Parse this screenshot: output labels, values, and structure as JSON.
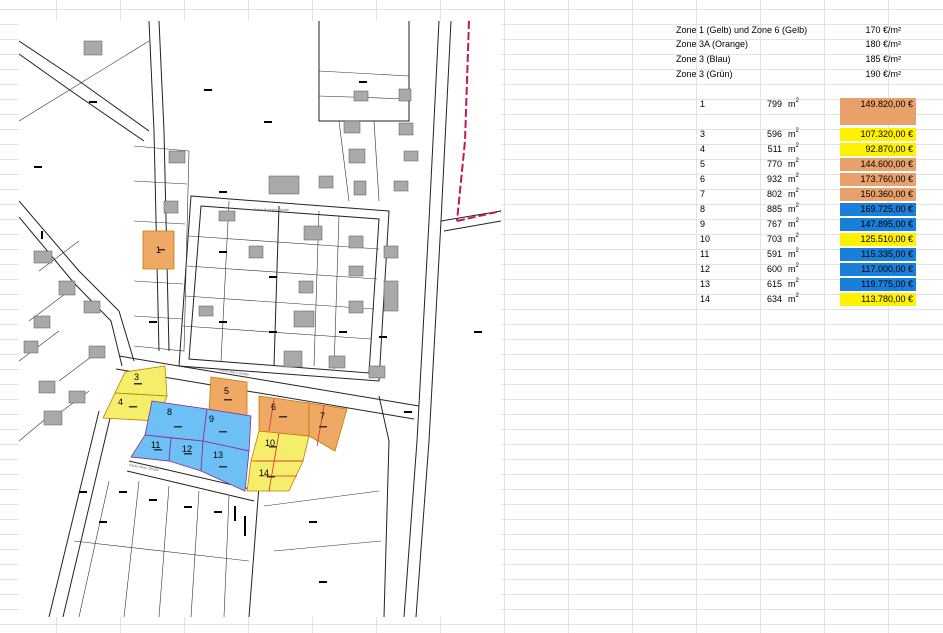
{
  "colors": {
    "gelb": "#fff200",
    "orange": "#e9a16b",
    "blau": "#1a7fd8",
    "gruen": "#1a7fd8",
    "map_yellow": "#f5ee6a",
    "map_orange": "#f0a865",
    "map_blue": "#6cc0f5"
  },
  "zones": [
    {
      "name": "Zone 1 (Gelb) und Zone 6 (Gelb)",
      "price": "170 €/m²"
    },
    {
      "name": "Zone 3A (Orange)",
      "price": "180 €/m²"
    },
    {
      "name": "Zone 3 (Blau)",
      "price": "185 €/m²"
    },
    {
      "name": "Zone 3 (Grün)",
      "price": "190 €/m²"
    }
  ],
  "unit": "m",
  "unit_sup": "2",
  "plots": [
    {
      "nr": "1",
      "area": "799",
      "price": "149.820,00 €",
      "zone": "orange"
    },
    {
      "nr": "3",
      "area": "596",
      "price": "107.320,00 €",
      "zone": "gelb"
    },
    {
      "nr": "4",
      "area": "511",
      "price": "92.870,00 €",
      "zone": "gelb"
    },
    {
      "nr": "5",
      "area": "770",
      "price": "144.600,00 €",
      "zone": "orange"
    },
    {
      "nr": "6",
      "area": "932",
      "price": "173.760,00 €",
      "zone": "orange"
    },
    {
      "nr": "7",
      "area": "802",
      "price": "150.360,00 €",
      "zone": "orange"
    },
    {
      "nr": "8",
      "area": "885",
      "price": "169.725,00 €",
      "zone": "blau"
    },
    {
      "nr": "9",
      "area": "767",
      "price": "147.895,00 €",
      "zone": "blau"
    },
    {
      "nr": "10",
      "area": "703",
      "price": "125.510,00 €",
      "zone": "gelb"
    },
    {
      "nr": "11",
      "area": "591",
      "price": "115.335,00 €",
      "zone": "blau"
    },
    {
      "nr": "12",
      "area": "600",
      "price": "117.000,00 €",
      "zone": "blau"
    },
    {
      "nr": "13",
      "area": "615",
      "price": "119.775,00 €",
      "zone": "blau"
    },
    {
      "nr": "14",
      "area": "634",
      "price": "113.780,00 €",
      "zone": "gelb"
    }
  ],
  "map": {
    "plot_labels": [
      "1",
      "3",
      "4",
      "5",
      "6",
      "7",
      "8",
      "9",
      "10",
      "11",
      "12",
      "13",
      "14"
    ],
    "street_labels": [
      "Sankt-Rudolph-Straße",
      "Paulo-Stern-Straße",
      "Paulo-Stern-Straße"
    ]
  }
}
